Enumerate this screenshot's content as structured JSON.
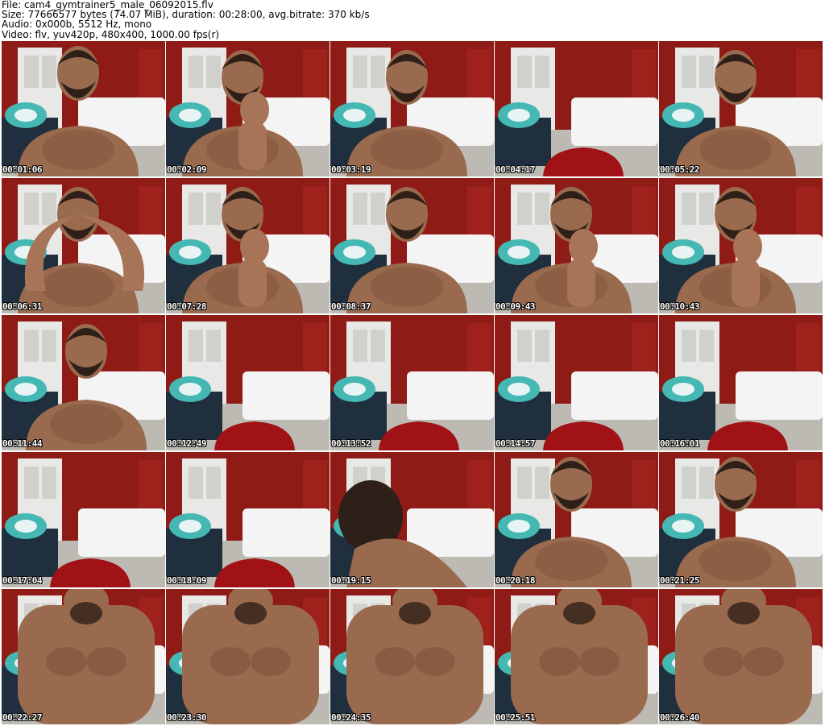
{
  "header": {
    "file": "File: cam4_gymtrainer5_male_06092015.flv",
    "size": "Size: 77666577 bytes (74.07 MiB), duration: 00:28:00, avg.bitrate: 370 kb/s",
    "audio": "Audio: 0x000b, 5512 Hz, mono",
    "video": "Video: flv, yuv420p, 480x400, 1000.00 fps(r)"
  },
  "colors": {
    "wall": "#8e1b16",
    "door": "#e8e8e6",
    "bed": "#f4f4f4",
    "sofa": "#1f2f3d",
    "pillow": "#46b8b4",
    "skin": "#9a6a4e",
    "hair": "#2e2018",
    "chair": "#a01216",
    "floor": "#bcbab2"
  },
  "thumbnails": [
    {
      "time": "00:01:06",
      "person": "close"
    },
    {
      "time": "00:02:09",
      "person": "hand"
    },
    {
      "time": "00:03:19",
      "person": "center"
    },
    {
      "time": "00:04:17",
      "person": "empty"
    },
    {
      "time": "00:05:22",
      "person": "center"
    },
    {
      "time": "00:06:31",
      "person": "arms"
    },
    {
      "time": "00:07:28",
      "person": "hand"
    },
    {
      "time": "00:08:37",
      "person": "center"
    },
    {
      "time": "00:09:43",
      "person": "hand"
    },
    {
      "time": "00:10:43",
      "person": "hand"
    },
    {
      "time": "00:11:44",
      "person": "left"
    },
    {
      "time": "00:12:49",
      "person": "empty"
    },
    {
      "time": "00:13:52",
      "person": "empty"
    },
    {
      "time": "00:14:57",
      "person": "empty"
    },
    {
      "time": "00:16:01",
      "person": "empty"
    },
    {
      "time": "00:17:04",
      "person": "empty"
    },
    {
      "time": "00:18:09",
      "person": "empty"
    },
    {
      "time": "00:19:15",
      "person": "bent"
    },
    {
      "time": "00:20:18",
      "person": "close"
    },
    {
      "time": "00:21:25",
      "person": "close"
    },
    {
      "time": "00:22:27",
      "person": "torso"
    },
    {
      "time": "00:23:30",
      "person": "torso"
    },
    {
      "time": "00:24:35",
      "person": "torso"
    },
    {
      "time": "00:25:51",
      "person": "torso"
    },
    {
      "time": "00:26:40",
      "person": "torso"
    }
  ]
}
